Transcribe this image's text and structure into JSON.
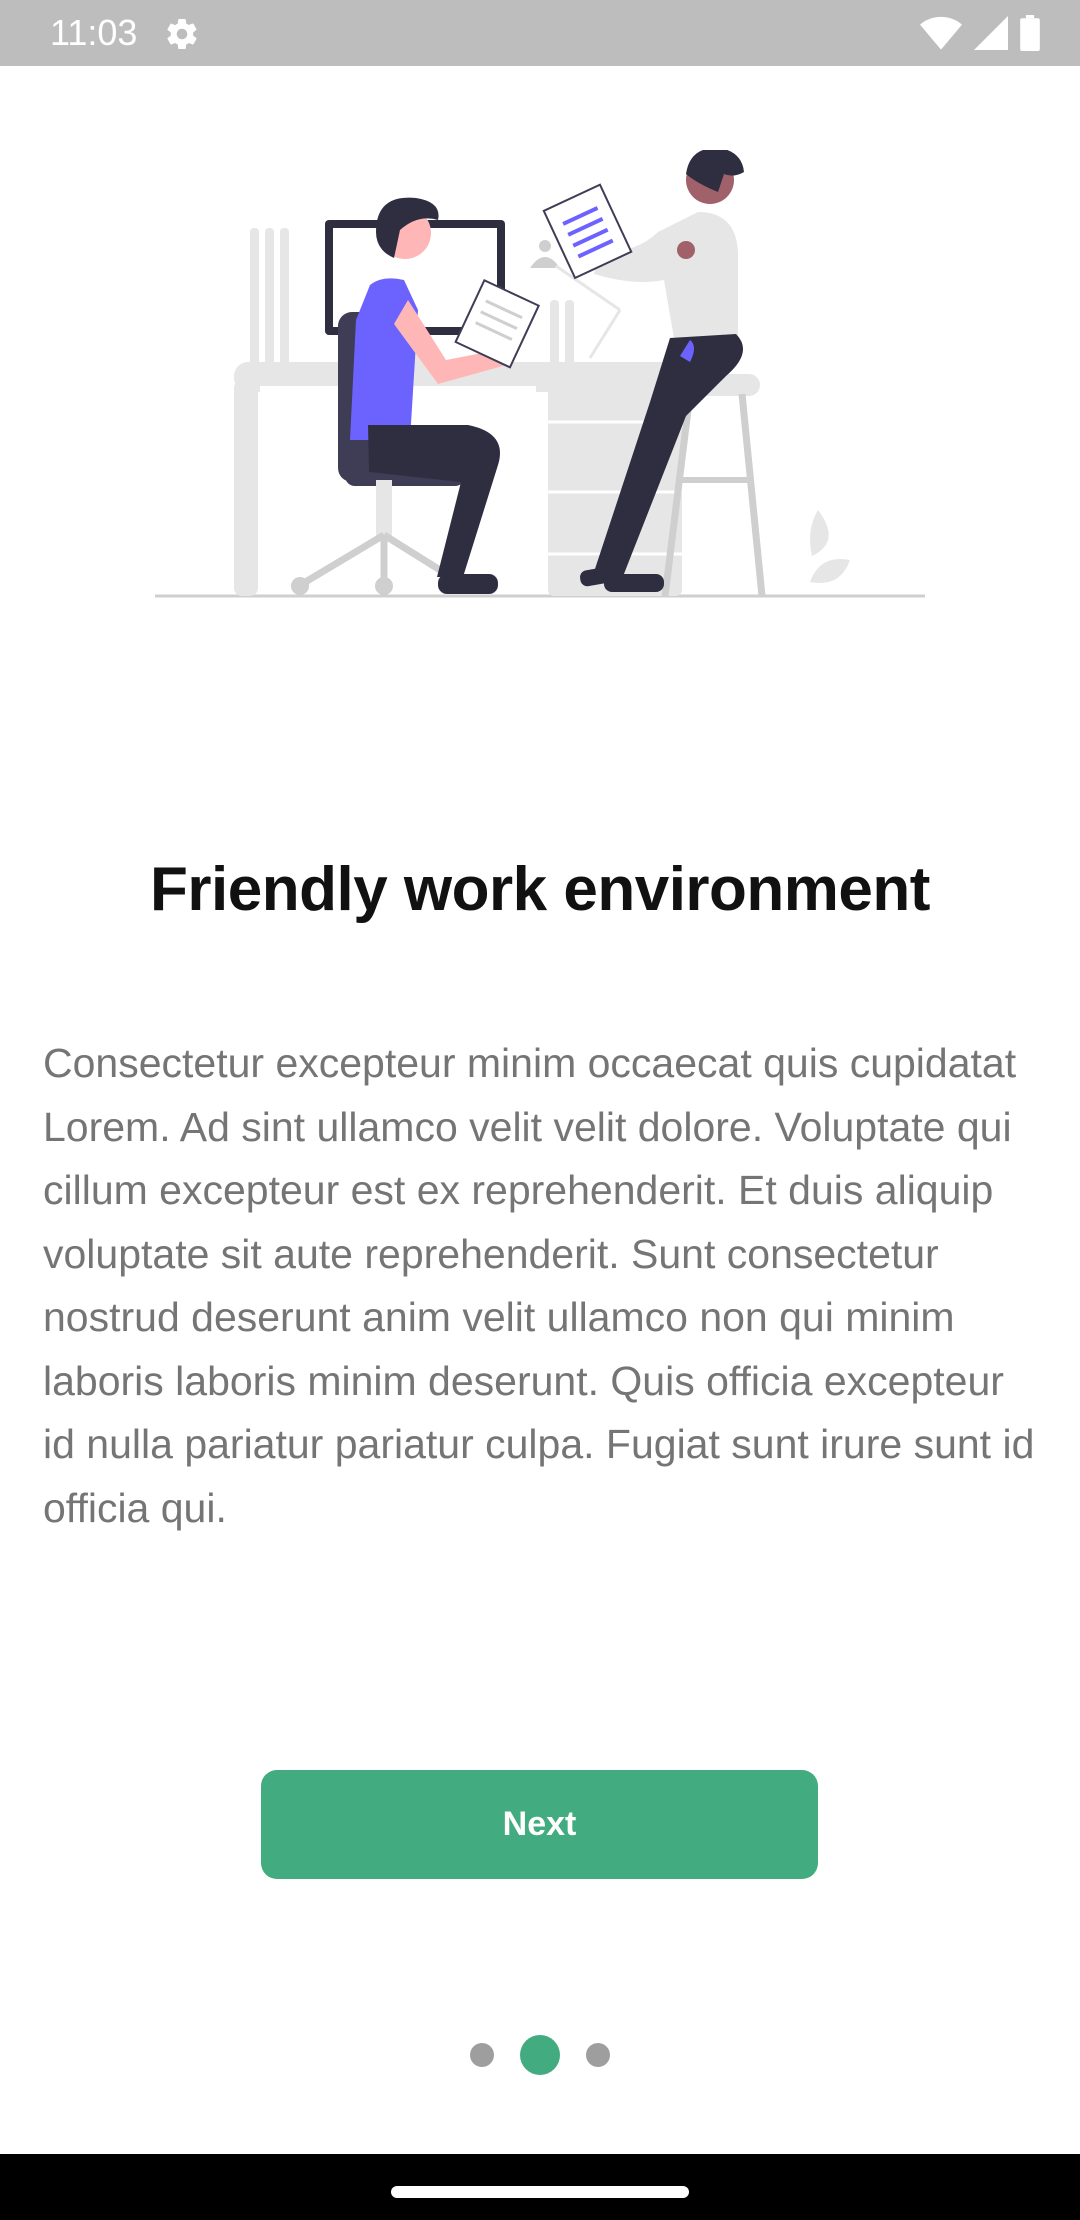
{
  "status_bar": {
    "time": "11:03",
    "icons": [
      "settings-gear-icon",
      "wifi-icon",
      "cell-signal-icon",
      "battery-icon"
    ]
  },
  "illustration": {
    "icon": "work-environment-illustration",
    "colors": {
      "accent": "#6c63ff",
      "dark": "#2f2e41",
      "light": "#e6e6e6",
      "skin": "#ffb6b6",
      "skin_dark": "#a0616a"
    }
  },
  "onboarding": {
    "title": "Friendly work environment",
    "description": "Consectetur excepteur minim occaecat quis cupidatat Lorem. Ad sint ullamco velit velit dolore. Voluptate qui cillum excepteur est ex reprehenderit. Et duis aliquip voluptate sit aute reprehenderit. Sunt consectetur nostrud deserunt anim velit ullamco non qui minim laboris laboris minim deserunt. Quis officia excepteur id nulla pariatur pariatur culpa. Fugiat sunt irure sunt id officia qui.",
    "next_label": "Next"
  },
  "pager": {
    "count": 3,
    "active_index": 1
  },
  "colors": {
    "primary": "#43ab80",
    "status_bar": "#bdbdbd",
    "dot_inactive": "#9e9e9e",
    "body_text": "#757575"
  }
}
